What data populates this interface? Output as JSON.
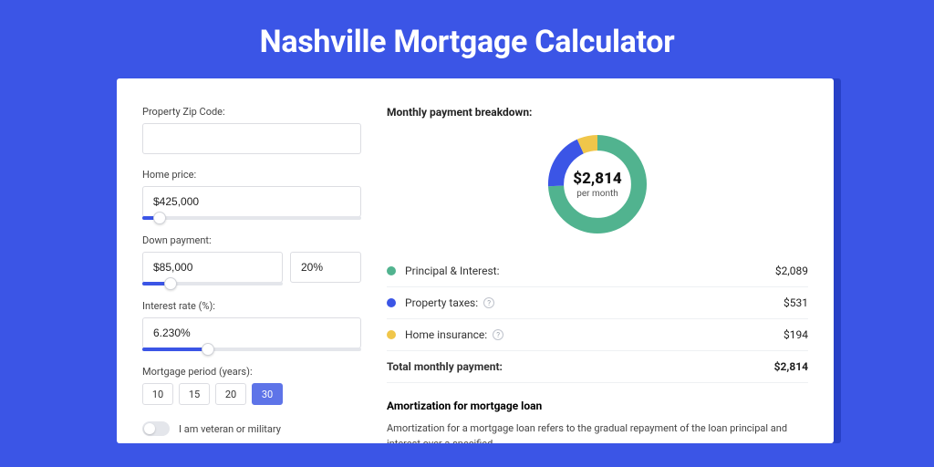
{
  "title": "Nashville Mortgage Calculator",
  "form": {
    "zip": {
      "label": "Property Zip Code:",
      "value": ""
    },
    "price": {
      "label": "Home price:",
      "value": "$425,000",
      "slider_pct": 8
    },
    "down": {
      "label": "Down payment:",
      "amount": "$85,000",
      "pct": "20%",
      "slider_pct": 20
    },
    "rate": {
      "label": "Interest rate (%):",
      "value": "6.230%",
      "slider_pct": 30
    },
    "period": {
      "label": "Mortgage period (years):",
      "options": [
        "10",
        "15",
        "20",
        "30"
      ],
      "selected": "30"
    },
    "veteran": {
      "label": "I am veteran or military",
      "on": false
    }
  },
  "breakdown": {
    "title": "Monthly payment breakdown:",
    "center_value": "$2,814",
    "center_label": "per month",
    "items": [
      {
        "key": "pi",
        "label": "Principal & Interest:",
        "value": "$2,089",
        "color": "green",
        "info": false
      },
      {
        "key": "tax",
        "label": "Property taxes:",
        "value": "$531",
        "color": "blue",
        "info": true
      },
      {
        "key": "ins",
        "label": "Home insurance:",
        "value": "$194",
        "color": "yellow",
        "info": true
      }
    ],
    "total": {
      "label": "Total monthly payment:",
      "value": "$2,814"
    }
  },
  "amort": {
    "title": "Amortization for mortgage loan",
    "text": "Amortization for a mortgage loan refers to the gradual repayment of the loan principal and interest over a specified"
  },
  "chart_data": {
    "type": "pie",
    "title": "Monthly payment breakdown",
    "series": [
      {
        "name": "Principal & Interest",
        "value": 2089,
        "color": "#51b38f"
      },
      {
        "name": "Property taxes",
        "value": 531,
        "color": "#3b55e6"
      },
      {
        "name": "Home insurance",
        "value": 194,
        "color": "#f0c64a"
      }
    ],
    "total": 2814,
    "center_label": "$2,814 per month"
  }
}
